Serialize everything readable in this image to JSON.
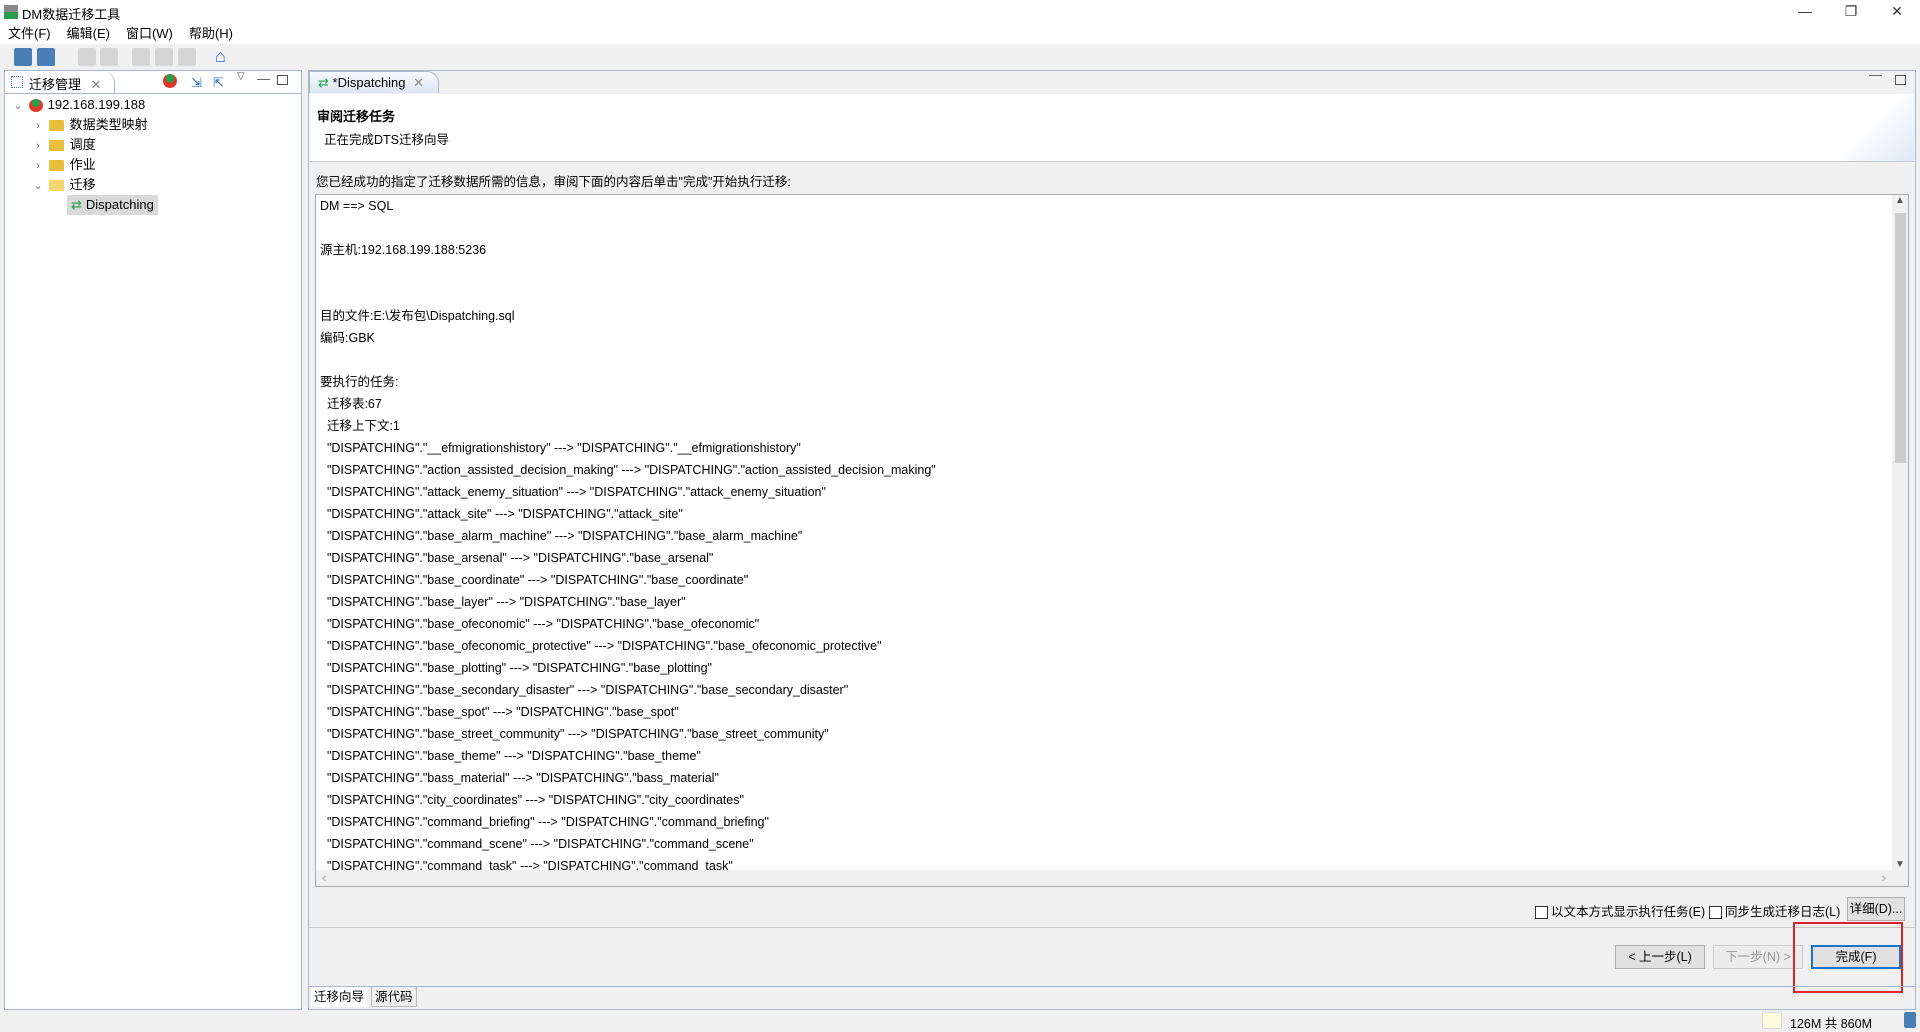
{
  "window": {
    "title": "DM数据迁移工具",
    "minimize": "—",
    "restore": "❐",
    "close": "✕"
  },
  "menu": [
    "文件(F)",
    "编辑(E)",
    "窗口(W)",
    "帮助(H)"
  ],
  "toolbar_icons": [
    "save-icon",
    "save-all-icon",
    "undo-icon",
    "redo-icon",
    "cut-icon",
    "copy-icon",
    "paste-icon",
    "home-icon"
  ],
  "left_panel": {
    "tab": "迁移管理",
    "tree": [
      {
        "label": "192.168.199.188",
        "level": 0,
        "expanded": true,
        "icon": "server-icon"
      },
      {
        "label": "数据类型映射",
        "level": 1,
        "expanded": false,
        "icon": "folder-icon"
      },
      {
        "label": "调度",
        "level": 1,
        "expanded": false,
        "icon": "folder-icon"
      },
      {
        "label": "作业",
        "level": 1,
        "expanded": false,
        "icon": "folder-icon"
      },
      {
        "label": "迁移",
        "level": 1,
        "expanded": true,
        "icon": "folder-open-icon"
      },
      {
        "label": "Dispatching",
        "level": 2,
        "selected": true,
        "icon": "migration-icon"
      }
    ]
  },
  "editor": {
    "tab": "*Dispatching",
    "header_title": "审阅迁移任务",
    "header_subtitle": "正在完成DTS迁移向导",
    "message": "您已经成功的指定了迁移数据所需的信息，审阅下面的内容后单击\"完成\"开始执行迁移:",
    "lines": [
      "DM ==> SQL",
      "",
      "源主机:192.168.199.188:5236",
      "",
      "",
      "目的文件:E:\\发布包\\Dispatching.sql",
      "编码:GBK",
      "",
      "要执行的任务:",
      "  迁移表:67",
      "  迁移上下文:1",
      "  \"DISPATCHING\".\"__efmigrationshistory\" ---> \"DISPATCHING\".\"__efmigrationshistory\"",
      "  \"DISPATCHING\".\"action_assisted_decision_making\" ---> \"DISPATCHING\".\"action_assisted_decision_making\"",
      "  \"DISPATCHING\".\"attack_enemy_situation\" ---> \"DISPATCHING\".\"attack_enemy_situation\"",
      "  \"DISPATCHING\".\"attack_site\" ---> \"DISPATCHING\".\"attack_site\"",
      "  \"DISPATCHING\".\"base_alarm_machine\" ---> \"DISPATCHING\".\"base_alarm_machine\"",
      "  \"DISPATCHING\".\"base_arsenal\" ---> \"DISPATCHING\".\"base_arsenal\"",
      "  \"DISPATCHING\".\"base_coordinate\" ---> \"DISPATCHING\".\"base_coordinate\"",
      "  \"DISPATCHING\".\"base_layer\" ---> \"DISPATCHING\".\"base_layer\"",
      "  \"DISPATCHING\".\"base_ofeconomic\" ---> \"DISPATCHING\".\"base_ofeconomic\"",
      "  \"DISPATCHING\".\"base_ofeconomic_protective\" ---> \"DISPATCHING\".\"base_ofeconomic_protective\"",
      "  \"DISPATCHING\".\"base_plotting\" ---> \"DISPATCHING\".\"base_plotting\"",
      "  \"DISPATCHING\".\"base_secondary_disaster\" ---> \"DISPATCHING\".\"base_secondary_disaster\"",
      "  \"DISPATCHING\".\"base_spot\" ---> \"DISPATCHING\".\"base_spot\"",
      "  \"DISPATCHING\".\"base_street_community\" ---> \"DISPATCHING\".\"base_street_community\"",
      "  \"DISPATCHING\".\"base_theme\" ---> \"DISPATCHING\".\"base_theme\"",
      "  \"DISPATCHING\".\"bass_material\" ---> \"DISPATCHING\".\"bass_material\"",
      "  \"DISPATCHING\".\"city_coordinates\" ---> \"DISPATCHING\".\"city_coordinates\"",
      "  \"DISPATCHING\".\"command_briefing\" ---> \"DISPATCHING\".\"command_briefing\"",
      "  \"DISPATCHING\".\"command_scene\" ---> \"DISPATCHING\".\"command_scene\"",
      "  \"DISPATCHING\".\"command_task\" ---> \"DISPATCHING\".\"command_task\""
    ],
    "checkbox_text_mode": "以文本方式显示执行任务(E)",
    "checkbox_sync_log": "同步生成迁移日志(L)",
    "details_button": "详细(D)...",
    "back_button": "< 上一步(L)",
    "next_button": "下一步(N) >",
    "finish_button": "完成(F)",
    "bottom_tabs": [
      "迁移向导",
      "源代码"
    ]
  },
  "status": {
    "memory": "126M 共 860M"
  },
  "colors": {
    "highlight_box": "#d9232e",
    "finish_border": "#1a73c9",
    "tree_selected": "#d9d9d9"
  }
}
